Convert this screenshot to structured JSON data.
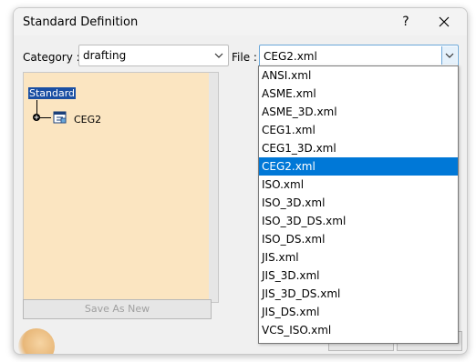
{
  "window": {
    "title": "Standard Definition",
    "help_label": "?",
    "close_label": "✕"
  },
  "category": {
    "label": "Category :",
    "value": "drafting"
  },
  "file": {
    "label": "File :",
    "value": "CEG2.xml",
    "options": [
      "ANSI.xml",
      "ASME.xml",
      "ASME_3D.xml",
      "CEG1.xml",
      "CEG1_3D.xml",
      "CEG2.xml",
      "ISO.xml",
      "ISO_3D.xml",
      "ISO_3D_DS.xml",
      "ISO_DS.xml",
      "JIS.xml",
      "JIS_3D.xml",
      "JIS_3D_DS.xml",
      "JIS_DS.xml",
      "VCS_ISO.xml"
    ],
    "selected_index": 5
  },
  "tree": {
    "root_label": "Standard",
    "node_label": "CEG2"
  },
  "buttons": {
    "save_as_new": "Save As New"
  },
  "colors": {
    "selection": "#0078d7",
    "tree_background": "#fbe5c1",
    "tree_root_highlight": "#1a4fa3"
  }
}
